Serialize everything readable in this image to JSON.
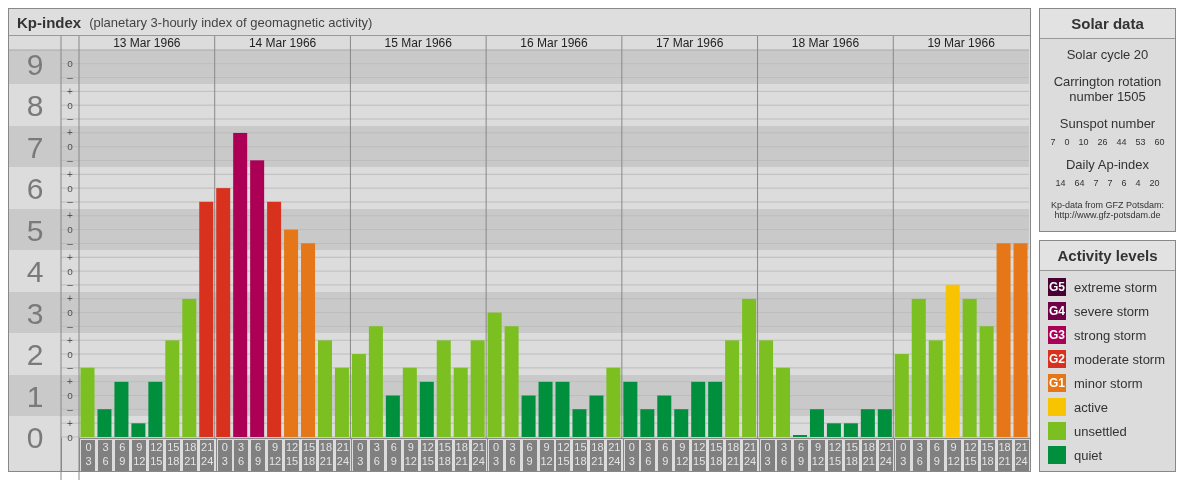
{
  "title": {
    "name": "Kp-index",
    "subtitle": "(planetary 3-hourly index of geomagnetic activity)"
  },
  "kp_chart": {
    "chart_data": {
      "type": "bar",
      "ylim": [
        0,
        9.33
      ],
      "grid": true,
      "categories": [
        "0 3",
        "3 6",
        "6 9",
        "9 12",
        "12 15",
        "15 18",
        "18 21",
        "21 24",
        "0 3",
        "3 6",
        "6 9",
        "9 12",
        "12 15",
        "15 18",
        "18 21",
        "21 24",
        "0 3",
        "3 6",
        "6 9",
        "9 12",
        "12 15",
        "15 18",
        "18 21",
        "21 24",
        "0 3",
        "3 6",
        "6 9",
        "9 12",
        "12 15",
        "15 18",
        "18 21",
        "21 24",
        "0 3",
        "3 6",
        "6 9",
        "9 12",
        "12 15",
        "15 18",
        "18 21",
        "21 24",
        "0 3",
        "3 6",
        "6 9",
        "9 12",
        "12 15",
        "15 18",
        "18 21",
        "21 24",
        "0 3",
        "3 6",
        "6 9",
        "9 12",
        "12 15",
        "15 18",
        "18 21",
        "21 24"
      ],
      "yticks": [
        {
          "value": 0,
          "label": "0"
        },
        {
          "value": 1,
          "label": "1"
        },
        {
          "value": 2,
          "label": "2"
        },
        {
          "value": 3,
          "label": "3"
        },
        {
          "value": 4,
          "label": "4"
        },
        {
          "value": 5,
          "label": "5"
        },
        {
          "value": 6,
          "label": "6"
        },
        {
          "value": 7,
          "label": "7"
        },
        {
          "value": 8,
          "label": "8"
        },
        {
          "value": 9,
          "label": "9"
        }
      ],
      "values": [
        1.67,
        0.67,
        1.33,
        0.33,
        1.33,
        2.33,
        3.33,
        5.67,
        6,
        7.33,
        6.67,
        5.67,
        5,
        4.67,
        2.33,
        1.67,
        2,
        2.67,
        1,
        1.67,
        1.33,
        2.33,
        1.67,
        2.33,
        3,
        2.67,
        1,
        1.33,
        1.33,
        0.67,
        1,
        1.67,
        1.33,
        0.67,
        1,
        0.67,
        1.33,
        1.33,
        2.33,
        3.33,
        2.33,
        1.67,
        0,
        0.67,
        0.33,
        0.33,
        0.67,
        0.67,
        2,
        3.33,
        2.33,
        3.67,
        3.33,
        2.67,
        4.67,
        4.67
      ]
    },
    "scale_marks": [
      "o",
      "–",
      "+",
      "o",
      "–",
      "+",
      "o",
      "–",
      "+",
      "o",
      "–",
      "+",
      "o",
      "–",
      "+",
      "o",
      "–",
      "+",
      "o",
      "–",
      "+",
      "o",
      "–",
      "+",
      "o",
      "–",
      "+",
      "o"
    ],
    "days": [
      {
        "date": "13 Mar 1966"
      },
      {
        "date": "14 Mar 1966"
      },
      {
        "date": "15 Mar 1966"
      },
      {
        "date": "16 Mar 1966"
      },
      {
        "date": "17 Mar 1966"
      },
      {
        "date": "18 Mar 1966"
      },
      {
        "date": "19 Mar 1966"
      }
    ]
  },
  "solar_data": {
    "title": "Solar data",
    "solar_cycle": "Solar cycle 20",
    "carrington": "Carrington rotation number 1505",
    "sunspot_label": "Sunspot number",
    "sunspot_numbers": [
      "7",
      "0",
      "10",
      "26",
      "44",
      "53",
      "60"
    ],
    "ap_label": "Daily Ap-index",
    "ap_values": [
      "14",
      "64",
      "7",
      "7",
      "6",
      "4",
      "20"
    ],
    "source": "Kp-data from GFZ Potsdam:",
    "source_url": "http://www.gfz-potsdam.de"
  },
  "activity_levels": {
    "title": "Activity levels",
    "items": [
      {
        "badge": "G5",
        "label": "extreme storm",
        "color": "#4b0033"
      },
      {
        "badge": "G4",
        "label": "severe storm",
        "color": "#6f0045"
      },
      {
        "badge": "G3",
        "label": "strong storm",
        "color": "#ab0055"
      },
      {
        "badge": "G2",
        "label": "moderate storm",
        "color": "#d8311d"
      },
      {
        "badge": "G1",
        "label": "minor storm",
        "color": "#e57718"
      },
      {
        "label": "active",
        "color": "#f8c300"
      },
      {
        "label": "unsettled",
        "color": "#7bbf21"
      },
      {
        "label": "quiet",
        "color": "#008f3d"
      }
    ]
  }
}
